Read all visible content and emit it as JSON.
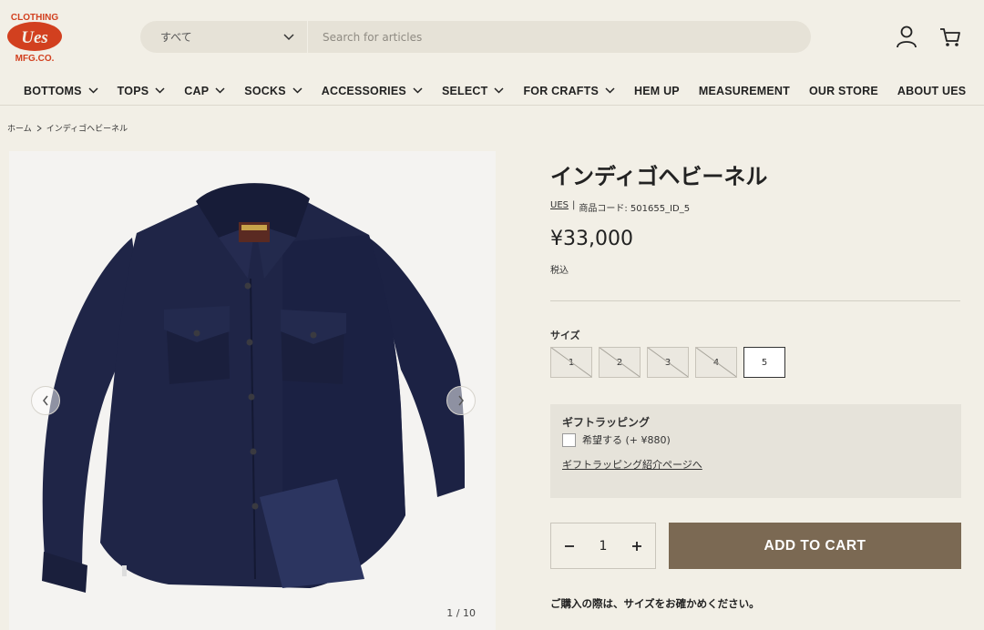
{
  "brand": {
    "logo_top": "CLOTHING",
    "logo_mid": "Ues",
    "logo_bottom": "MFG.CO."
  },
  "search": {
    "category": "すべて",
    "placeholder": "Search for articles"
  },
  "nav": [
    {
      "label": "BOTTOMS",
      "dropdown": true
    },
    {
      "label": "TOPS",
      "dropdown": true
    },
    {
      "label": "CAP",
      "dropdown": true
    },
    {
      "label": "SOCKS",
      "dropdown": true
    },
    {
      "label": "ACCESSORIES",
      "dropdown": true
    },
    {
      "label": "SELECT",
      "dropdown": true
    },
    {
      "label": "FOR CRAFTS",
      "dropdown": true
    },
    {
      "label": "HEM UP",
      "dropdown": false
    },
    {
      "label": "MEASUREMENT",
      "dropdown": false
    },
    {
      "label": "OUR STORE",
      "dropdown": false
    },
    {
      "label": "ABOUT UES",
      "dropdown": false
    }
  ],
  "breadcrumb": {
    "home": "ホーム",
    "current": "インディゴヘビーネル"
  },
  "gallery": {
    "counter": "1 / 10"
  },
  "product": {
    "title": "インディゴヘビーネル",
    "brand": "UES",
    "separator": "|",
    "code": "商品コード: 501655_ID_5",
    "price": "¥33,000",
    "tax": "税込",
    "size_label": "サイズ",
    "sizes": [
      {
        "label": "1",
        "available": false
      },
      {
        "label": "2",
        "available": false
      },
      {
        "label": "3",
        "available": false
      },
      {
        "label": "4",
        "available": false
      },
      {
        "label": "5",
        "available": true
      }
    ]
  },
  "gift": {
    "title": "ギフトラッピング",
    "option": "希望する (+ ¥880)",
    "link": "ギフトラッピング紹介ページへ"
  },
  "cart": {
    "quantity": "1",
    "button": "ADD TO CART",
    "notice": "ご購入の際は、サイズをお確かめください。"
  },
  "colors": {
    "background": "#f2efe6",
    "accent": "#7b6953",
    "logo_red": "#d2401f",
    "shirt": "#1f2547"
  }
}
